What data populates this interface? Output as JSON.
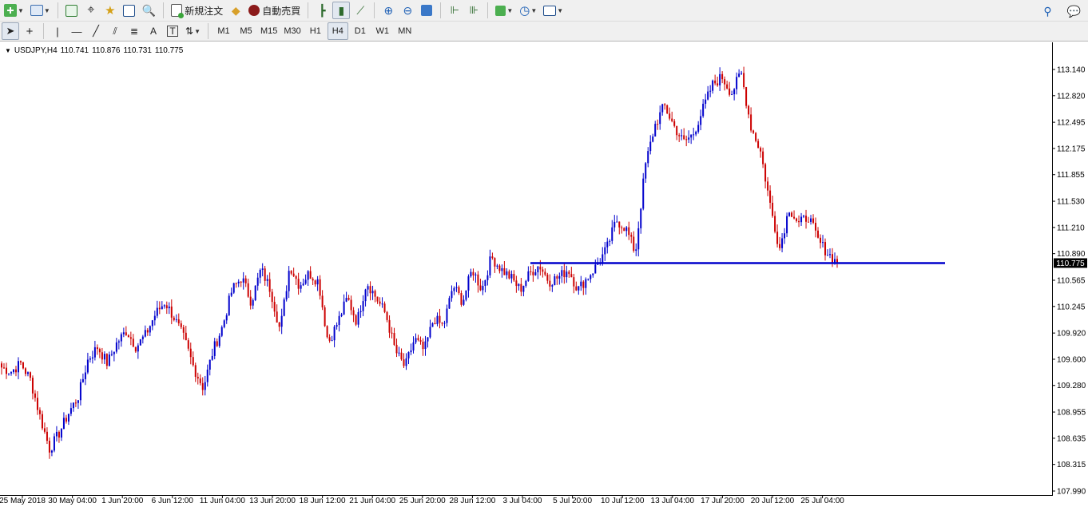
{
  "toolbar1": {
    "new_order_label": "新規注文",
    "auto_trading_label": "自動売買"
  },
  "toolbar2": {
    "timeframes": [
      "M1",
      "M5",
      "M15",
      "M30",
      "H1",
      "H4",
      "D1",
      "W1",
      "MN"
    ],
    "active_timeframe": "H4",
    "text_tool_label": "A"
  },
  "chart": {
    "symbol": "USDJPY,H4",
    "open": "110.741",
    "high": "110.876",
    "low": "110.731",
    "close": "110.775",
    "current_price_label": "110.775",
    "horizontal_line_price": 110.775,
    "colors": {
      "bull": "#0000cc",
      "bear": "#cc0000",
      "hline": "#0000cc",
      "price_tag_bg": "#000000"
    }
  },
  "chart_data": {
    "type": "candlestick",
    "y_tick_labels": [
      "113.140",
      "112.820",
      "112.495",
      "112.175",
      "111.855",
      "111.530",
      "111.210",
      "110.890",
      "110.565",
      "110.245",
      "109.920",
      "109.600",
      "109.280",
      "108.955",
      "108.635",
      "108.315",
      "107.990"
    ],
    "x_tick_labels": [
      "25 May 2018",
      "30 May 04:00",
      "1 Jun 20:00",
      "6 Jun 12:00",
      "11 Jun 04:00",
      "13 Jun 20:00",
      "18 Jun 12:00",
      "21 Jun 04:00",
      "25 Jun 20:00",
      "28 Jun 12:00",
      "3 Jul 04:00",
      "5 Jul 20:00",
      "10 Jul 12:00",
      "13 Jul 04:00",
      "17 Jul 20:00",
      "20 Jul 12:00",
      "25 Jul 04:00"
    ],
    "ylim": [
      107.99,
      113.14
    ],
    "close_path": [
      109.5,
      109.45,
      109.55,
      109.35,
      108.9,
      108.5,
      108.7,
      108.95,
      109.15,
      109.6,
      109.75,
      109.55,
      109.8,
      109.95,
      109.75,
      109.9,
      110.15,
      110.3,
      110.1,
      109.85,
      109.5,
      109.25,
      109.7,
      110.0,
      110.45,
      110.6,
      110.3,
      110.7,
      110.45,
      109.95,
      110.75,
      110.5,
      110.65,
      110.55,
      109.8,
      110.05,
      110.35,
      110.05,
      110.55,
      110.35,
      110.15,
      109.7,
      109.5,
      109.85,
      109.7,
      110.1,
      110.0,
      110.5,
      110.3,
      110.7,
      110.45,
      110.85,
      110.7,
      110.6,
      110.45,
      110.65,
      110.75,
      110.55,
      110.6,
      110.7,
      110.45,
      110.6,
      110.75,
      110.95,
      111.3,
      111.2,
      110.9,
      111.95,
      112.45,
      112.7,
      112.45,
      112.25,
      112.35,
      112.65,
      112.95,
      113.05,
      112.85,
      113.1,
      112.45,
      112.15,
      111.5,
      110.95,
      111.45,
      111.25,
      111.35,
      111.05,
      110.9,
      110.775
    ]
  }
}
